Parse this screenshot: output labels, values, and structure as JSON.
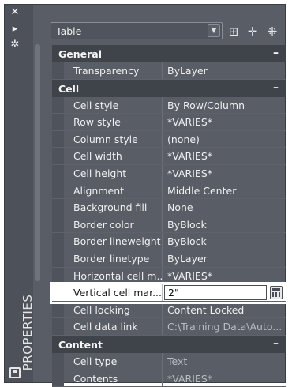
{
  "palette": {
    "title": "PROPERTIES",
    "strip_icons": [
      "close-icon",
      "pin-icon",
      "settings-icon"
    ],
    "bottom_icon": "palette-menu-icon"
  },
  "toolbar": {
    "object_type": "Table",
    "icons": [
      "toggle-pickadd-icon",
      "select-objects-icon",
      "quick-select-icon"
    ]
  },
  "sections": [
    {
      "title": "General",
      "rows": [
        {
          "label": "Transparency",
          "value": "ByLayer"
        }
      ]
    },
    {
      "title": "Cell",
      "rows": [
        {
          "label": "Cell style",
          "value": "By Row/Column"
        },
        {
          "label": "Row style",
          "value": "*VARIES*"
        },
        {
          "label": "Column style",
          "value": "(none)"
        },
        {
          "label": "Cell width",
          "value": "*VARIES*"
        },
        {
          "label": "Cell height",
          "value": "*VARIES*"
        },
        {
          "label": "Alignment",
          "value": "Middle Center"
        },
        {
          "label": "Background fill",
          "value": " None"
        },
        {
          "label": "Border color",
          "value": "ByBlock"
        },
        {
          "label": "Border lineweight",
          "value": "ByBlock"
        },
        {
          "label": "Border linetype",
          "value": "ByLayer"
        },
        {
          "label": "Horizontal cell m...",
          "value": "*VARIES*"
        },
        {
          "label": "Vertical cell mar...",
          "value": "2\"",
          "editing": true
        },
        {
          "label": "Cell locking",
          "value": "Content Locked"
        },
        {
          "label": "Cell data link",
          "value": "C:\\Training  Data\\Auto...",
          "dim": true
        }
      ]
    },
    {
      "title": "Content",
      "rows": [
        {
          "label": "Cell type",
          "value": "Text",
          "dim": true
        },
        {
          "label": "Contents",
          "value": "*VARIES*",
          "dim": true
        }
      ]
    }
  ],
  "colors": {
    "panel_bg": "#585d66",
    "section_bg": "#3f444b",
    "highlight": "#ffffff"
  }
}
